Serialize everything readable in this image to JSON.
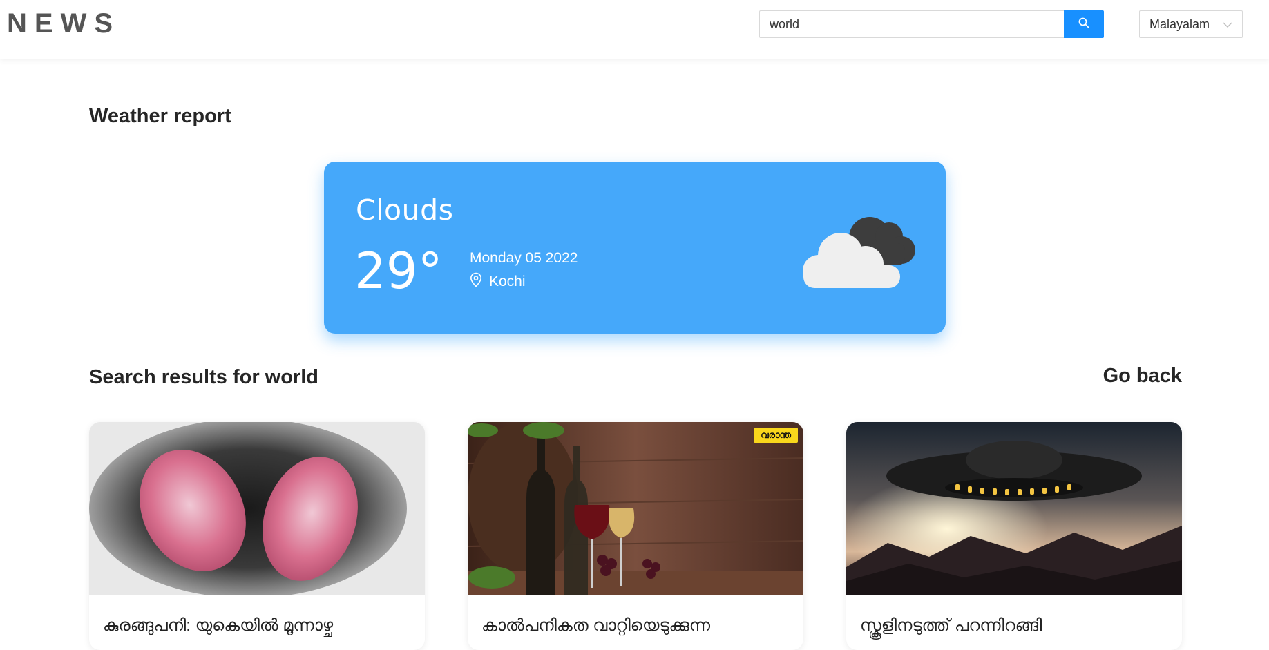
{
  "header": {
    "logo": "NEWS",
    "search_value": "world",
    "language": "Malayalam"
  },
  "weather": {
    "section_title": "Weather report",
    "condition": "Clouds",
    "temperature": "29°",
    "date": "Monday 05 2022",
    "location": "Kochi"
  },
  "results": {
    "title": "Search results for world",
    "go_back": "Go back",
    "cards": [
      {
        "title": "കുരങ്ങുപനി: യുകെയിൽ മൂന്നാഴ്ച",
        "image": "monkeypox-virus"
      },
      {
        "title": "കാൽപനികത വാറ്റിയെടുക്കുന്ന",
        "image": "wine-bottles",
        "badge": "വരാന്ത"
      },
      {
        "title": "സ്കൂളിനടുത്ത് പറന്നിറങ്ങി",
        "image": "ufo-sunset"
      }
    ]
  },
  "colors": {
    "weather_card": "#45a8fa",
    "search_button": "#1890ff",
    "badge": "#f9d71c"
  }
}
